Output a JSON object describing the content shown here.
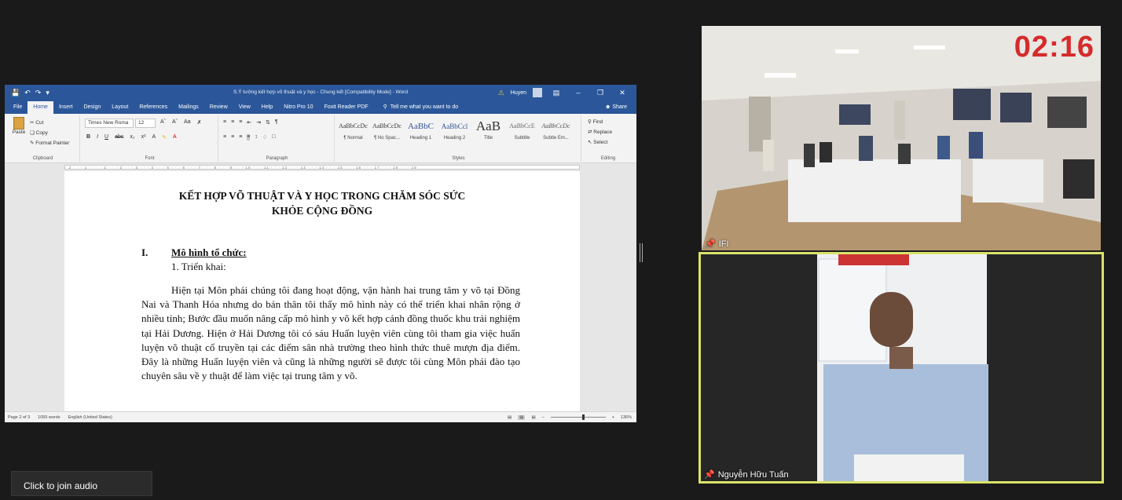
{
  "word": {
    "title": "S.Ý tưởng kết hợp võ thuật và y học - Chung kết [Compatibility Mode] - Word",
    "user": "Huyen",
    "tabs": [
      "File",
      "Home",
      "Insert",
      "Design",
      "Layout",
      "References",
      "Mailings",
      "Review",
      "View",
      "Help",
      "Nitro Pro 10",
      "Foxit Reader PDF"
    ],
    "tell_me": "Tell me what you want to do",
    "share": "Share",
    "ribbon": {
      "paste": "Paste",
      "cut": "Cut",
      "copy": "Copy",
      "format_painter": "Format Painter",
      "clipboard": "Clipboard",
      "font_name": "Times New Roma",
      "font_size": "12",
      "font": "Font",
      "paragraph": "Paragraph",
      "styles_label": "Styles",
      "styles": [
        {
          "sample": "AaBbCcDc",
          "name": "¶ Normal"
        },
        {
          "sample": "AaBbCcDc",
          "name": "¶ No Spac..."
        },
        {
          "sample": "AaBbC",
          "name": "Heading 1"
        },
        {
          "sample": "AaBbCcl",
          "name": "Heading 2"
        },
        {
          "sample": "AaB",
          "name": "Title"
        },
        {
          "sample": "AaBbCcE",
          "name": "Subtitle"
        },
        {
          "sample": "AaBbCcDc",
          "name": "Subtle Em..."
        }
      ],
      "find": "Find",
      "replace": "Replace",
      "select": "Select",
      "editing": "Editing"
    },
    "document": {
      "heading_line1": "KẾT HỢP VÕ THUẬT VÀ Y HỌC TRONG CHĂM SÓC SỨC",
      "heading_line2": "KHỎE CỘNG ĐỒNG",
      "section_num": "I.",
      "section_title": "Mô hình tổ chức:",
      "sub_item": "1.   Triển khai:",
      "paragraph": "Hiện tại Môn phái chúng tôi đang hoạt động, vận hành hai trung tâm y võ tại Đồng Nai và Thanh Hóa nhưng do bản thân tôi thấy mô hình này có thể triển khai nhân rộng ở nhiều tỉnh; Bước đầu muốn nâng cấp mô hình y võ kết hợp cánh đồng thuốc khu trải nghiệm tại Hải Dương. Hiện ở Hải Dương tôi có sáu Huấn luyện viên cùng tôi tham gia việc huấn luyện võ thuật cổ truyền tại các điểm sân nhà trường theo hình thức thuê mượn địa điểm. Đây là những Huấn luyện viên và cũng là những người sẽ được tôi cùng Môn phái đào tạo chuyên sâu về y thuật để làm việc tại trung tâm y võ."
    },
    "status": {
      "page": "Page 2 of 3",
      "words": "1055 words",
      "language": "English (United States)",
      "zoom": "136%"
    }
  },
  "video": {
    "timer": "02:16",
    "tile1_name": "IFI",
    "tile2_name": "Nguyễn Hữu Tuấn"
  },
  "audio_button": "Click to join audio",
  "colors": {
    "word_blue": "#2b579a",
    "active_speaker": "#d9e36a",
    "timer_red": "#d52b2b"
  }
}
